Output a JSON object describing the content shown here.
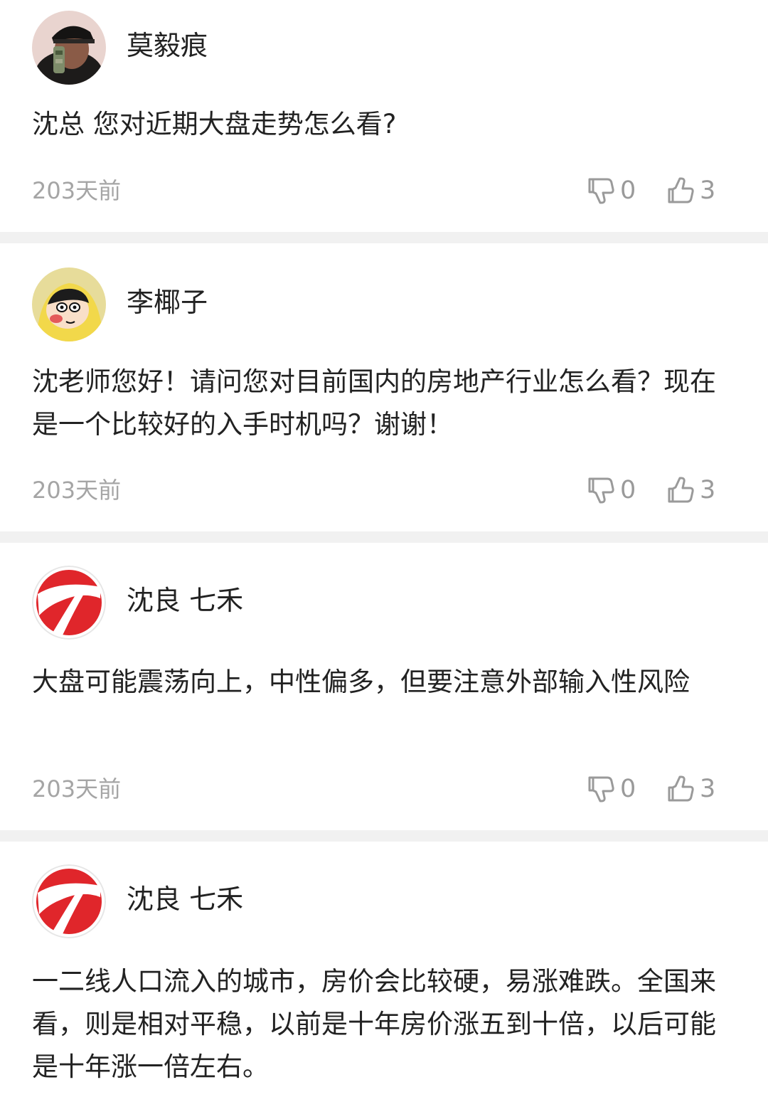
{
  "comments": [
    {
      "username": "莫毅痕",
      "content": "沈总 您对近期大盘走势怎么看?",
      "time": "203天前",
      "dislikes": "0",
      "likes": "3"
    },
    {
      "username": "李椰子",
      "content": "沈老师您好！请问您对目前国内的房地产行业怎么看？现在是一个比较好的入手时机吗？谢谢！",
      "time": "203天前",
      "dislikes": "0",
      "likes": "3"
    },
    {
      "username": "沈良 七禾",
      "content": "大盘可能震荡向上，中性偏多，但要注意外部输入性风险",
      "time": "203天前",
      "dislikes": "0",
      "likes": "3"
    },
    {
      "username": "沈良 七禾",
      "content": "一二线人口流入的城市，房价会比较硬，易涨难跌。全国来看，则是相对平稳，以前是十年房价涨五到十倍，以后可能是十年涨一倍左右。"
    }
  ],
  "colors": {
    "accent_red": "#e0262b",
    "meta_gray": "#a5a5a5",
    "separator": "#f1f1f1"
  }
}
